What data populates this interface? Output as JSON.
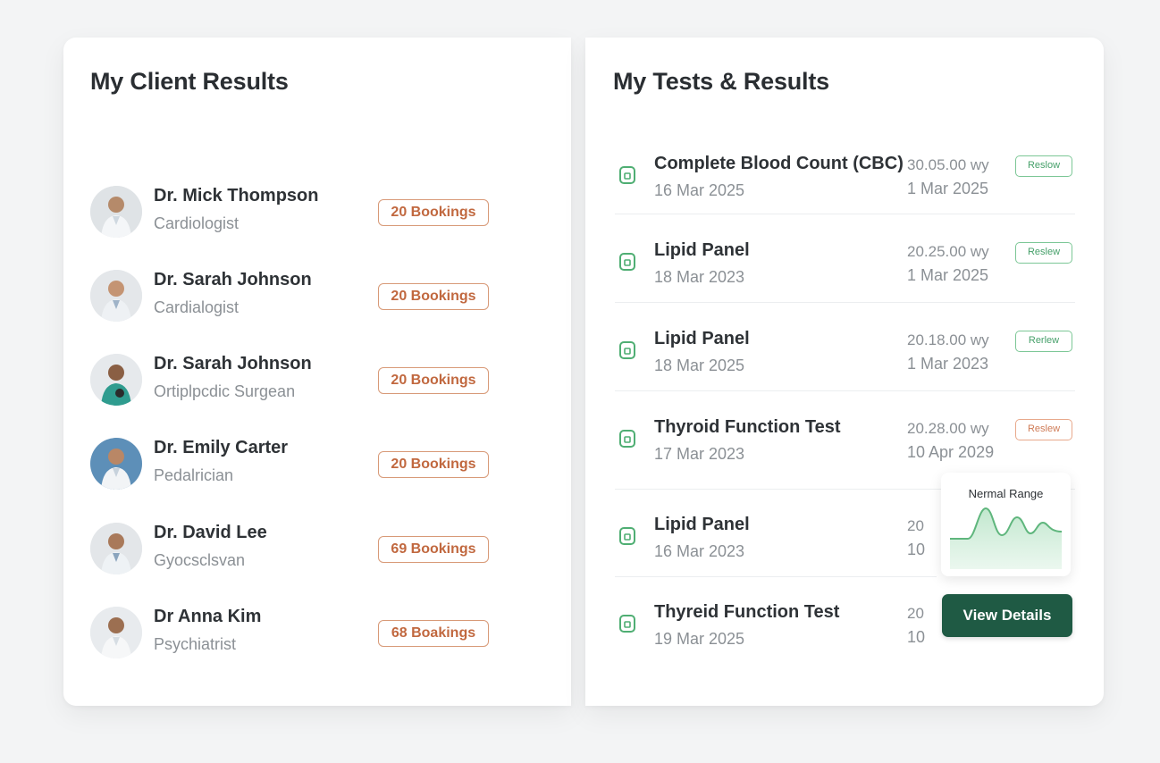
{
  "left_panel": {
    "title": "My Client Results",
    "doctors": [
      {
        "name": "Dr. Mick Thompson",
        "specialty": "Cardiologist",
        "bookings": "20 Bookings"
      },
      {
        "name": "Dr. Sarah Johnson",
        "specialty": "Cardialogist",
        "bookings": "20 Bookings"
      },
      {
        "name": "Dr. Sarah Johnson",
        "specialty": "Ortiplpcdic Surgean",
        "bookings": "20 Bookings"
      },
      {
        "name": "Dr. Emily Carter",
        "specialty": "Pedalrician",
        "bookings": "20 Bookings"
      },
      {
        "name": "Dr. David Lee",
        "specialty": "Gyocsclsvan",
        "bookings": "69 Bookings"
      },
      {
        "name": "Dr Anna Kim",
        "specialty": "Psychiatrist",
        "bookings": "68 Boakings"
      }
    ]
  },
  "right_panel": {
    "title": "My Tests & Results",
    "tests": [
      {
        "name": "Complete Blood Count (CBC)",
        "date": "16 Mar 2025",
        "value": "30.05.00 wy",
        "ref": "1 Mar 2025",
        "action": "Reslow",
        "status": "normal"
      },
      {
        "name": "Lipid Panel",
        "date": "18 Mar 2023",
        "value": "20.25.00 wy",
        "ref": "1 Mar 2025",
        "action": "Reslew",
        "status": "normal"
      },
      {
        "name": "Lipid Panel",
        "date": "18 Mar 2025",
        "value": "20.18.00 wy",
        "ref": "1 Mar 2023",
        "action": "Rerlew",
        "status": "normal"
      },
      {
        "name": "Thyroid Function Test",
        "date": "17 Mar 2023",
        "value": "20.28.00 wy",
        "ref": "10 Apr 2029",
        "action": "Reslew",
        "status": "warning"
      },
      {
        "name": "Lipid Panel",
        "date": "16 Mar 2023",
        "value": "20",
        "ref": "10",
        "action": "",
        "status": "normal"
      },
      {
        "name": "Thyreid Function Test",
        "date": "19 Mar 2025",
        "value": "20",
        "ref": "10",
        "action": "",
        "status": "normal"
      }
    ],
    "range_chart": {
      "title": "Nermal Range"
    },
    "view_details_label": "View Details"
  },
  "colors": {
    "badge_border": "#d89a78",
    "badge_text": "#c1683f",
    "review_green": "#46a06a",
    "review_orange": "#cf7b56",
    "primary_button": "#1f5a44",
    "chart_line": "#5fb67d"
  },
  "icons": {
    "test_item": "document-icon"
  }
}
